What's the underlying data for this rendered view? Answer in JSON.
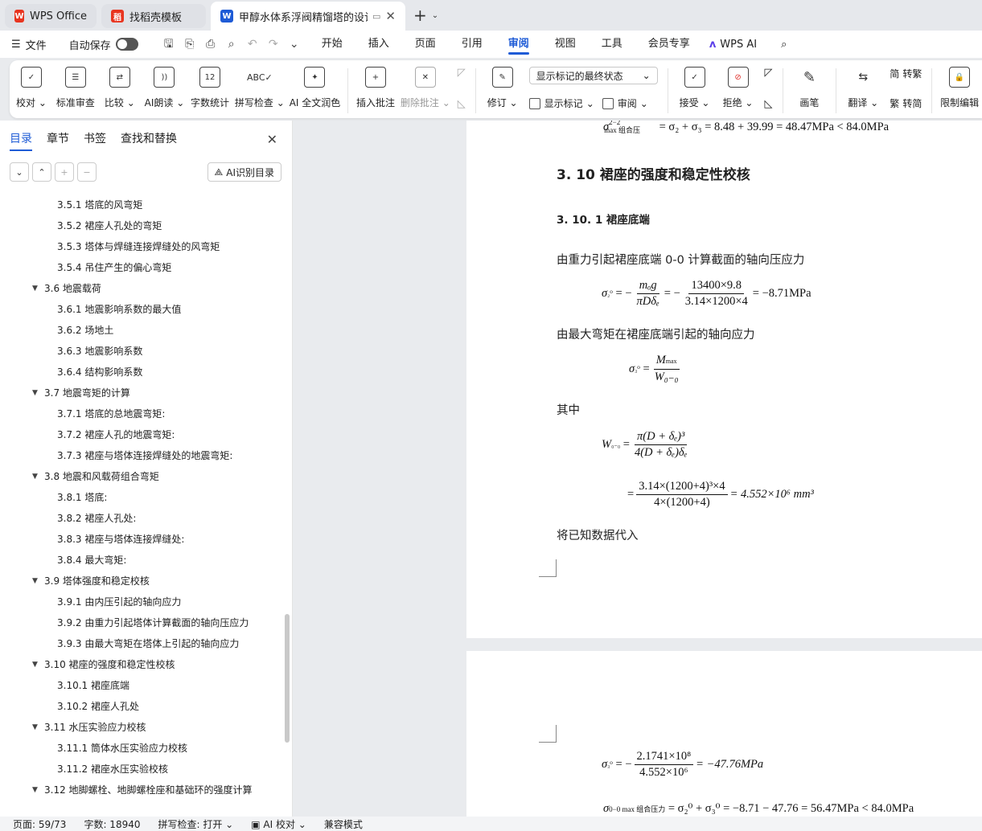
{
  "tabs": {
    "wps": "WPS Office",
    "template": "找稻壳模板",
    "document": "甲醇水体系浮阀精馏塔的设计"
  },
  "menubar": {
    "file": "文件",
    "autosave": "自动保存",
    "tabs": [
      "开始",
      "插入",
      "页面",
      "引用",
      "审阅",
      "视图",
      "工具",
      "会员专享"
    ],
    "active_tab": "审阅",
    "wps_ai": "WPS AI"
  },
  "ribbon": {
    "proofread": "校对",
    "standard_review": "标准审查",
    "compare": "比较",
    "ai_read": "AI朗读",
    "word_count": "字数统计",
    "spell_check": "拼写检查",
    "ai_polish": "AI 全文润色",
    "insert_comment": "插入批注",
    "delete_comment": "删除批注",
    "revise": "修订",
    "markup_select": "显示标记的最终状态",
    "show_markup": "显示标记",
    "review": "审阅",
    "accept": "接受",
    "reject": "拒绝",
    "pen": "画笔",
    "translate": "翻译",
    "to_traditional": "转繁",
    "to_simplified": "转简",
    "restrict_edit": "限制编辑"
  },
  "sidebar": {
    "tabs": [
      "目录",
      "章节",
      "书签",
      "查找和替换"
    ],
    "ai_toc": "AI识别目录",
    "toc": [
      {
        "level": 3,
        "text": "3.5.1 塔底的风弯矩"
      },
      {
        "level": 3,
        "text": "3.5.2 裙座人孔处的弯矩"
      },
      {
        "level": 3,
        "text": "3.5.3 塔体与焊缝连接焊缝处的风弯矩"
      },
      {
        "level": 3,
        "text": "3.5.4 吊住产生的偏心弯矩"
      },
      {
        "level": 2,
        "text": "3.6 地震载荷"
      },
      {
        "level": 3,
        "text": "3.6.1 地震影响系数的最大值"
      },
      {
        "level": 3,
        "text": "3.6.2 场地土"
      },
      {
        "level": 3,
        "text": "3.6.3 地震影响系数"
      },
      {
        "level": 3,
        "text": "3.6.4 结构影响系数"
      },
      {
        "level": 2,
        "text": "3.7 地震弯矩的计算"
      },
      {
        "level": 3,
        "text": "3.7.1 塔底的总地震弯矩:"
      },
      {
        "level": 3,
        "text": "3.7.2 裙座人孔的地震弯矩:"
      },
      {
        "level": 3,
        "text": "3.7.3 裙座与塔体连接焊缝处的地震弯矩:"
      },
      {
        "level": 2,
        "text": "3.8 地震和风载荷组合弯矩"
      },
      {
        "level": 3,
        "text": "3.8.1 塔底:"
      },
      {
        "level": 3,
        "text": "3.8.2 裙座人孔处:"
      },
      {
        "level": 3,
        "text": "3.8.3 裙座与塔体连接焊缝处:"
      },
      {
        "level": 3,
        "text": "3.8.4 最大弯矩:"
      },
      {
        "level": 2,
        "text": "3.9 塔体强度和稳定校核"
      },
      {
        "level": 3,
        "text": "3.9.1 由内压引起的轴向应力"
      },
      {
        "level": 3,
        "text": "3.9.2 由重力引起塔体计算截面的轴向压应力"
      },
      {
        "level": 3,
        "text": "3.9.3 由最大弯矩在塔体上引起的轴向应力"
      },
      {
        "level": 2,
        "text": "3.10 裙座的强度和稳定性校核"
      },
      {
        "level": 3,
        "text": "3.10.1 裙座底端"
      },
      {
        "level": 3,
        "text": "3.10.2 裙座人孔处"
      },
      {
        "level": 2,
        "text": "3.11 水压实验应力校核"
      },
      {
        "level": 3,
        "text": "3.11.1 筒体水压实验应力校核"
      },
      {
        "level": 3,
        "text": "3.11.2 裙座水压实验校核"
      },
      {
        "level": 2,
        "text": "3.12 地脚螺栓、地脚螺栓座和基础环的强度计算"
      }
    ]
  },
  "document": {
    "heading": "3. 10 裙座的强度和稳定性校核",
    "subheading": "3. 10. 1 裙座底端",
    "para1": "由重力引起裙座底端 0-0 计算截面的轴向压应力",
    "para2": "由最大弯矩在裙座底端引起的轴向应力",
    "para3": "其中",
    "para4": "将已知数据代入",
    "eq_top": "= σ₂ + σ₃ = 8.48 + 39.99 = 48.47MPa < 84.0MPa",
    "eq_s2_num1": "mₒg",
    "eq_s2_den1": "πDδₑ",
    "eq_s2_num2": "13400×9.8",
    "eq_s2_den2": "3.14×1200×4",
    "eq_s2_result": "= −8.71MPa",
    "eq_s3_num": "M",
    "eq_s3_den": "W₀₋₀",
    "eq_w_num": "π(D + δₑ)³",
    "eq_w_den": "4(D + δₑ)δₑ",
    "eq_w2_num": "3.14×(1200+4)³×4",
    "eq_w2_den": "4×(1200+4)",
    "eq_w2_result": "= 4.552×10⁶ mm³",
    "eq_p2_num": "2.1741×10⁸",
    "eq_p2_den": "4.552×10⁶",
    "eq_p2_result": "= −47.76MPa",
    "eq_p2_last": "= σ₂⁰ + σ₃⁰ = −8.71 − 47.76 = 56.47MPa < 84.0MPa"
  },
  "status": {
    "page": "页面: 59/73",
    "words": "字数: 18940",
    "spell": "拼写检查: 打开",
    "ai_check": "AI 校对",
    "compat": "兼容模式"
  }
}
